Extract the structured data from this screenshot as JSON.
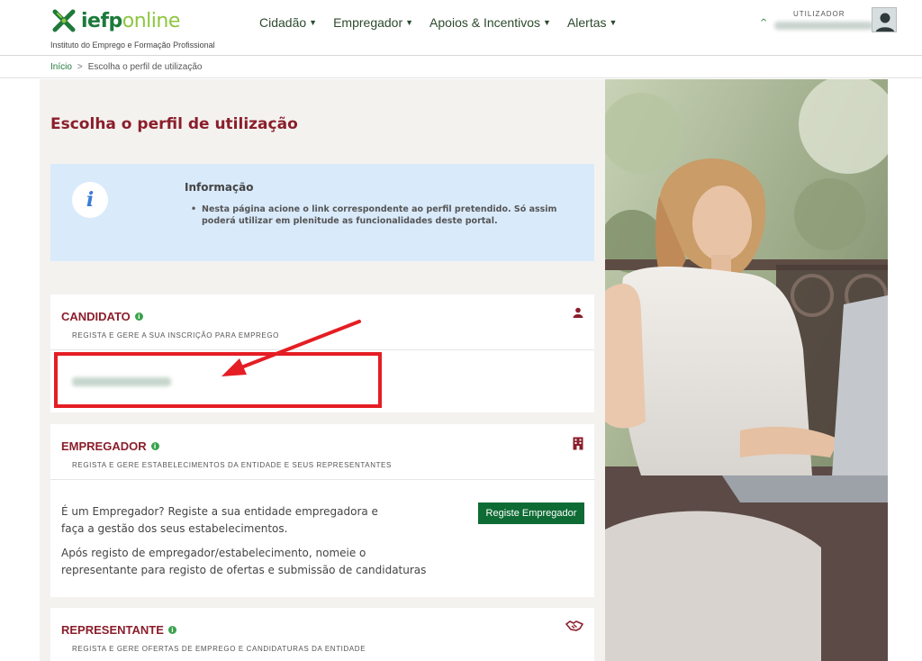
{
  "header": {
    "logo_part1": "iefp",
    "logo_part2": "online",
    "subtitle": "Instituto do Emprego e Formação Profissional",
    "nav": [
      {
        "label": "Cidadão"
      },
      {
        "label": "Empregador"
      },
      {
        "label": "Apoios & Incentivos"
      },
      {
        "label": "Alertas"
      }
    ],
    "user_label": "UTILIZADOR"
  },
  "breadcrumb": {
    "home": "Início",
    "separator": ">",
    "current": "Escolha o perfil de utilização"
  },
  "main": {
    "title": "Escolha o perfil de utilização",
    "info": {
      "title": "Informação",
      "text": "Nesta página acione o link correspondente ao perfil pretendido. Só assim poderá utilizar em plenitude as funcionalidades deste portal."
    },
    "cards": {
      "candidato": {
        "title": "CANDIDATO",
        "subtitle": "REGISTA E GERE A SUA INSCRIÇÃO PARA EMPREGO"
      },
      "empregador": {
        "title": "EMPREGADOR",
        "subtitle": "REGISTA E GERE ESTABELECIMENTOS DA ENTIDADE E SEUS REPRESENTANTES",
        "text1": "É um Empregador? Registe a sua entidade empregadora e faça a gestão dos seus estabelecimentos.",
        "text2": "Após registo de empregador/estabelecimento, nomeie o representante para registo de ofertas e submissão de candidaturas",
        "button": "Registe Empregador"
      },
      "representante": {
        "title": "REPRESENTANTE",
        "subtitle": "REGISTA E GERE OFERTAS DE EMPREGO E CANDIDATURAS DA ENTIDADE"
      }
    }
  },
  "colors": {
    "brand_green": "#1d7a3a",
    "accent_red": "#8b1e2b",
    "annotation_red": "#e41e24",
    "info_bg": "#d9eafb"
  }
}
